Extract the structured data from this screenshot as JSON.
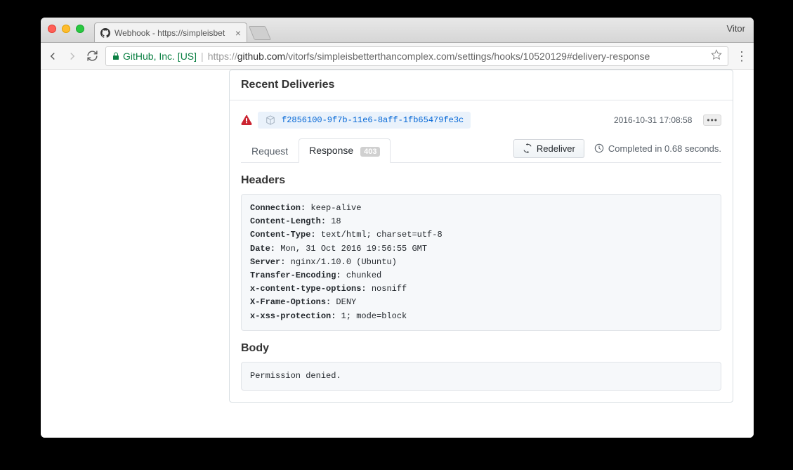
{
  "browser": {
    "profile_name": "Vitor",
    "tab_title": "Webhook - https://simpleisbet",
    "ev_badge": "GitHub, Inc. [US]",
    "url_proto": "https://",
    "url_host": "github.com",
    "url_path": "/vitorfs/simpleisbetterthancomplex.com/settings/hooks/10520129#delivery-response"
  },
  "panel": {
    "title": "Recent Deliveries"
  },
  "delivery": {
    "id": "f2856100-9f7b-11e6-8aff-1fb65479fe3c",
    "timestamp": "2016-10-31 17:08:58",
    "tabs": {
      "request": "Request",
      "response": "Response",
      "status_code": "403"
    },
    "redeliver_label": "Redeliver",
    "completed_label": "Completed in 0.68 seconds.",
    "headers_title": "Headers",
    "body_title": "Body",
    "headers": [
      {
        "k": "Connection:",
        "v": " keep-alive"
      },
      {
        "k": "Content-Length:",
        "v": " 18"
      },
      {
        "k": "Content-Type:",
        "v": " text/html; charset=utf-8"
      },
      {
        "k": "Date:",
        "v": " Mon, 31 Oct 2016 19:56:55 GMT"
      },
      {
        "k": "Server:",
        "v": " nginx/1.10.0 (Ubuntu)"
      },
      {
        "k": "Transfer-Encoding:",
        "v": " chunked"
      },
      {
        "k": "x-content-type-options:",
        "v": " nosniff"
      },
      {
        "k": "X-Frame-Options:",
        "v": " DENY"
      },
      {
        "k": "x-xss-protection:",
        "v": " 1; mode=block"
      }
    ],
    "body": "Permission denied."
  }
}
